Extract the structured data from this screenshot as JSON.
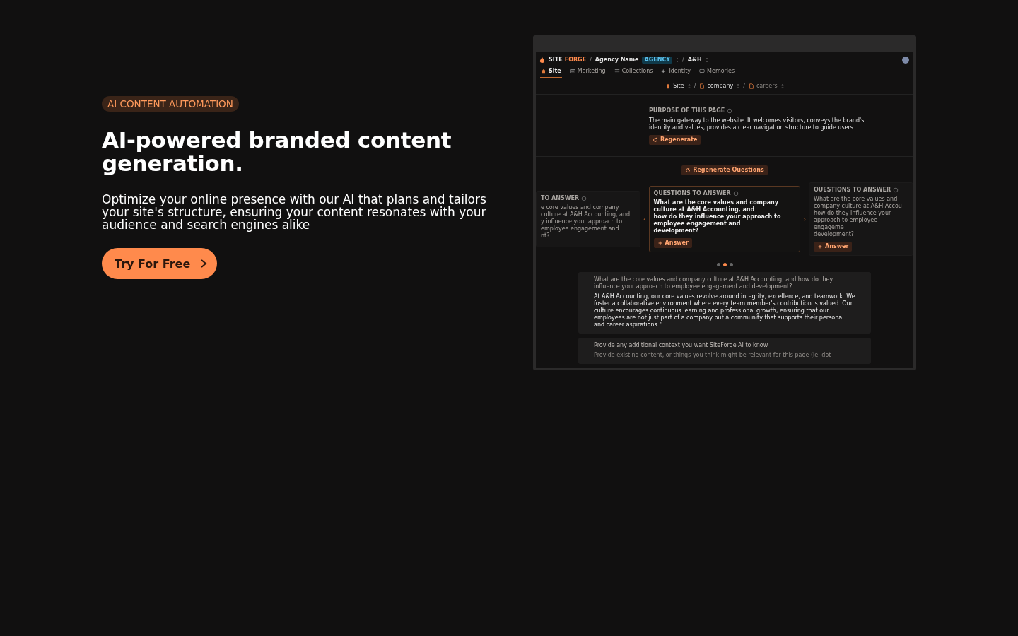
{
  "hero": {
    "eyebrow": "AI CONTENT AUTOMATION",
    "title": "AI-powered branded content generation.",
    "subtitle": "Optimize your online presence with our AI that plans and tailors your site's structure, ensuring your content resonates with your audience and search engines alike",
    "cta": "Try For Free"
  },
  "preview": {
    "logo": [
      "SITE",
      "FORGE"
    ],
    "crumbs": [
      {
        "sep": "/",
        "label": "Agency Name",
        "badge": "AGENCY"
      },
      {
        "sep": "/",
        "label": "A&H"
      }
    ],
    "tabs": [
      {
        "label": "Site",
        "kind": "site",
        "selected": true
      },
      {
        "label": "Marketing",
        "kind": "marketing",
        "selected": false
      },
      {
        "label": "Collections",
        "kind": "collections",
        "selected": false
      },
      {
        "label": "Identity",
        "kind": "identity",
        "selected": false
      },
      {
        "label": "Memories",
        "kind": "memories",
        "selected": false
      }
    ],
    "path": [
      {
        "label": "Site",
        "kind": "site",
        "muted": false
      },
      {
        "sep": "/",
        "label": "company",
        "kind": "page",
        "muted": false
      },
      {
        "sep": "/",
        "label": "careers",
        "kind": "page",
        "muted": true
      }
    ],
    "purpose": {
      "label": "PURPOSE OF THIS PAGE",
      "text": "The main gateway to the website. It welcomes visitors, conveys the brand's identity and values, provides a clear navigation structure to guide users.",
      "button": "Regenerate"
    },
    "regenerate_questions": "Regenerate Questions",
    "prev_arrow": "‹",
    "next_arrow": "›",
    "questions": [
      {
        "heading": "TO ANSWER",
        "lines": [
          "e core values and company culture at A&H Accounting, and",
          "y influence your approach to employee engagement and",
          "nt?"
        ],
        "selected": false
      },
      {
        "heading": "QUESTIONS TO ANSWER",
        "lines": [
          "What are the core values and company culture at A&H Accounting, and",
          "how do they influence your approach to employee engagement and",
          "development?"
        ],
        "button": "Answer",
        "selected": true
      },
      {
        "heading": "QUESTIONS TO ANSWER",
        "lines": [
          "What are the core values and company culture at A&H Accou",
          "how do they influence your approach to employee engageme",
          "development?"
        ],
        "button": "Answer",
        "selected": false
      }
    ],
    "slides": [
      {
        "selected": false
      },
      {
        "selected": true
      },
      {
        "selected": false
      }
    ],
    "answer": {
      "question": "What are the core values and company culture at A&H Accounting, and how do they influence your approach to employee engagement and development?",
      "text": "At A&H Accounting, our core values revolve around integrity, excellence, and teamwork. We foster a collaborative environment where every team member's contribution is valued. Our culture encourages continuous learning and professional growth, ensuring that our employees are not just part of a company but a community that supports their personal and career aspirations.\""
    },
    "context": {
      "label": "Provide any additional context you want SiteForge AI to know",
      "placeholder": "Provide existing content, or things you think might be relevant for this page (ie. dot"
    }
  }
}
